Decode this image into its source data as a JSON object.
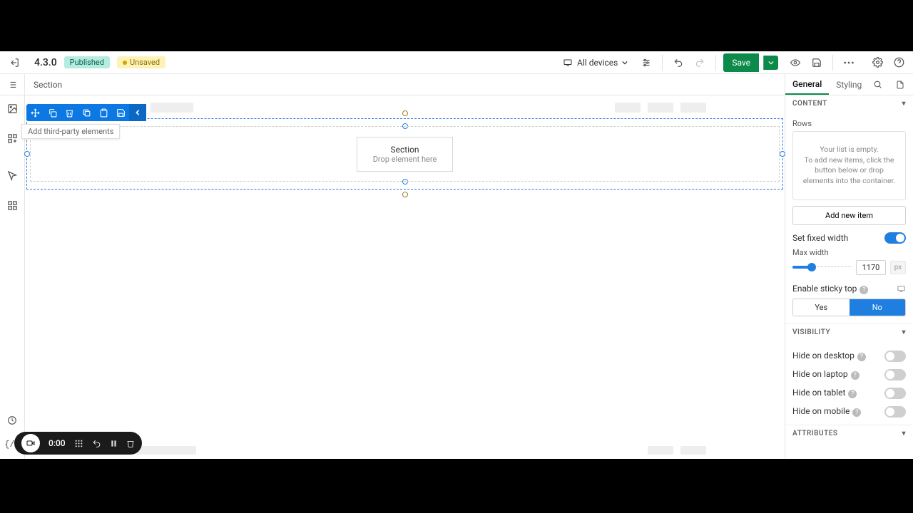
{
  "header": {
    "version": "4.3.0",
    "published_label": "Published",
    "unsaved_label": "Unsaved",
    "device_label": "All devices",
    "save_label": "Save"
  },
  "breadcrumb": {
    "current": "Section"
  },
  "rail_tooltip": "Add third-party elements",
  "canvas": {
    "section_title": "Section",
    "drop_hint": "Drop element here"
  },
  "inspector": {
    "tabs": {
      "general": "General",
      "styling": "Styling"
    },
    "content": {
      "heading": "CONTENT",
      "rows_label": "Rows",
      "empty_line1": "Your list is empty.",
      "empty_line2": "To add new items, click the button below or drop elements into the container.",
      "add_new": "Add new item",
      "fixed_width_label": "Set fixed width",
      "fixed_width_on": true,
      "max_width_label": "Max width",
      "max_width_value": "1170",
      "max_width_unit": "px",
      "slider_percent": 32,
      "sticky_label": "Enable sticky top",
      "sticky_options": {
        "yes": "Yes",
        "no": "No"
      },
      "sticky_value": "no"
    },
    "visibility": {
      "heading": "VISIBILITY",
      "items": [
        {
          "label": "Hide on desktop",
          "on": false
        },
        {
          "label": "Hide on laptop",
          "on": false
        },
        {
          "label": "Hide on tablet",
          "on": false
        },
        {
          "label": "Hide on mobile",
          "on": false
        }
      ]
    },
    "attributes": {
      "heading": "ATTRIBUTES"
    }
  },
  "video": {
    "time": "0:00"
  }
}
